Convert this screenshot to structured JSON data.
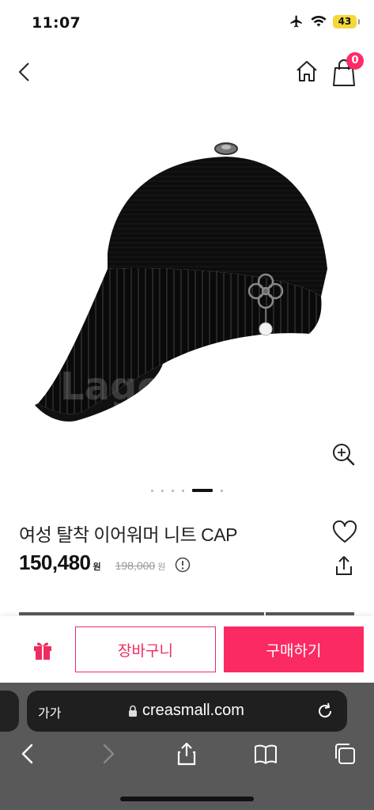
{
  "status_bar": {
    "time": "11:07",
    "battery": "43"
  },
  "header": {
    "cart_count": "0"
  },
  "product": {
    "watermark": "Lagona",
    "title": "여성 탈착 이어워머 니트 CAP",
    "price": "150,480",
    "price_unit": "원",
    "original_price": "198,000",
    "original_unit": "원",
    "image_index": 5,
    "image_count": 7
  },
  "actions": {
    "cart_label": "장바구니",
    "buy_label": "구매하기"
  },
  "browser": {
    "text_size_label": "가가",
    "url": "creasmall.com"
  },
  "colors": {
    "accent": "#fc2a62",
    "badge": "#ff2a68",
    "battery": "#f5d73a"
  }
}
